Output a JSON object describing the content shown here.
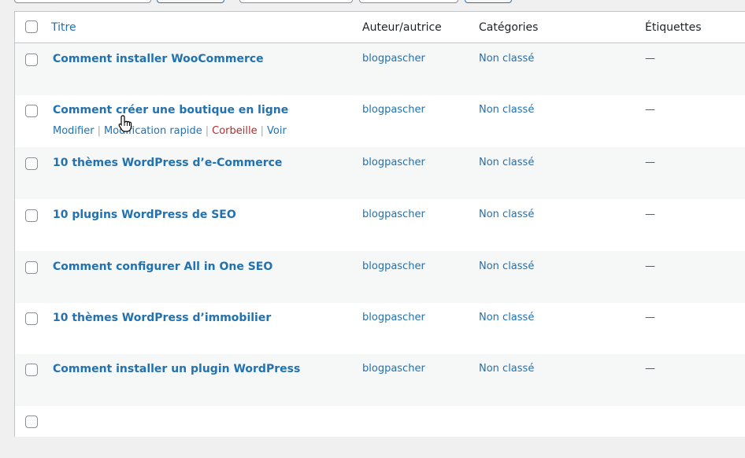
{
  "header": {
    "title_col": "Titre",
    "author_col": "Auteur/autrice",
    "categories_col": "Catégories",
    "tags_col": "Étiquettes"
  },
  "rows": [
    {
      "title": "Comment installer WooCommerce",
      "author": "blogpascher",
      "category": "Non classé",
      "tags": "—"
    },
    {
      "title": "Comment créer une boutique en ligne",
      "author": "blogpascher",
      "category": "Non classé",
      "tags": "—"
    },
    {
      "title": "10 thèmes WordPress d’e-Commerce",
      "author": "blogpascher",
      "category": "Non classé",
      "tags": "—"
    },
    {
      "title": "10 plugins WordPress de SEO",
      "author": "blogpascher",
      "category": "Non classé",
      "tags": "—"
    },
    {
      "title": "Comment configurer All in One SEO",
      "author": "blogpascher",
      "category": "Non classé",
      "tags": "—"
    },
    {
      "title": "10 thèmes WordPress d’immobilier",
      "author": "blogpascher",
      "category": "Non classé",
      "tags": "—"
    },
    {
      "title": "Comment installer un plugin WordPress",
      "author": "blogpascher",
      "category": "Non classé",
      "tags": "—"
    }
  ],
  "row_actions": {
    "edit": "Modifier",
    "quick_edit": "Modification rapide",
    "trash": "Corbeille",
    "view": "Voir",
    "separator": "|"
  }
}
